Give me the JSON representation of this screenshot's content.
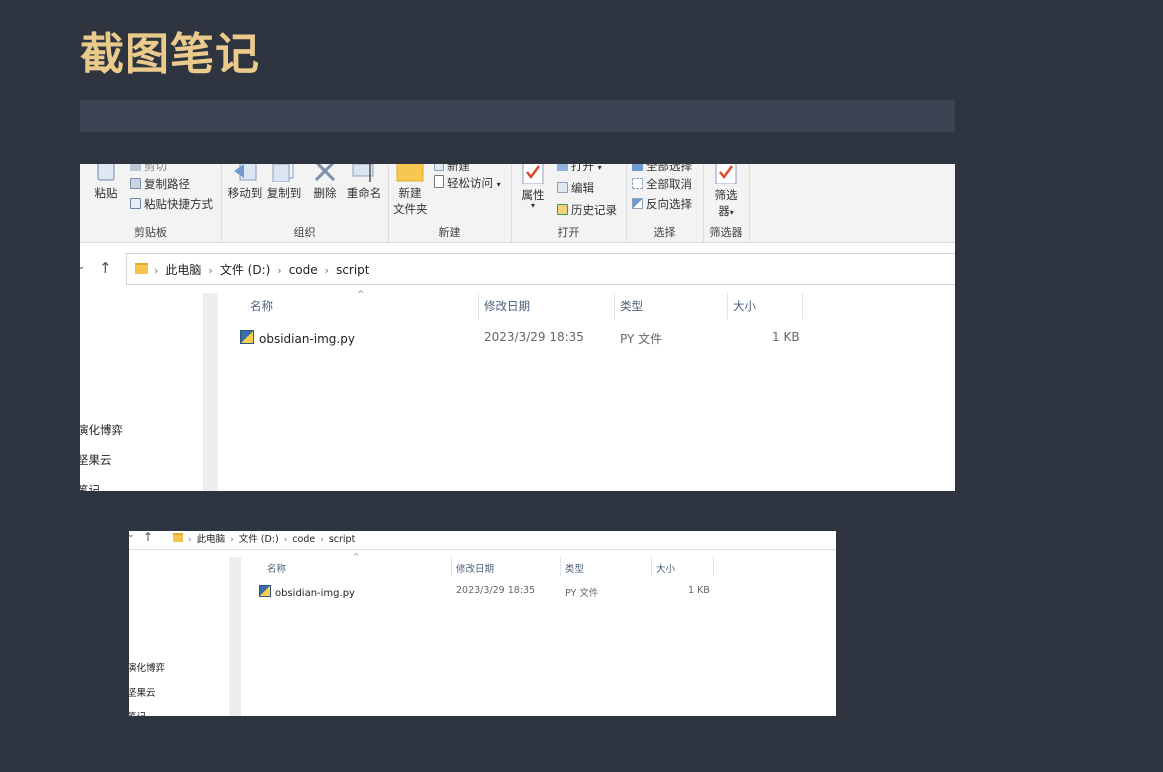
{
  "page": {
    "title": "截图笔记"
  },
  "shot1": {
    "ribbon": {
      "clipboard": {
        "paste": "粘贴",
        "cut": "剪切",
        "copy_path": "复制路径",
        "paste_shortcut": "粘贴快捷方式",
        "group": "剪贴板"
      },
      "organize": {
        "move_to": "移动到",
        "copy_to": "复制到",
        "delete": "删除",
        "rename": "重命名",
        "group": "组织"
      },
      "new": {
        "new_item": "新建",
        "easy_access": "轻松访问",
        "new_folder_1": "新建",
        "new_folder_2": "文件夹",
        "group": "新建"
      },
      "open": {
        "properties": "属性",
        "open": "打开",
        "edit": "编辑",
        "history": "历史记录",
        "group": "打开"
      },
      "select": {
        "select_all": "全部选择",
        "select_none": "全部取消",
        "invert": "反向选择",
        "group": "选择"
      },
      "filter": {
        "filter_1": "筛选",
        "filter_2": "器",
        "group": "筛选器"
      }
    },
    "address": {
      "crumbs": [
        "此电脑",
        "文件 (D:)",
        "code",
        "script"
      ]
    },
    "nav": {
      "items": [
        "演化博弈",
        "坚果云",
        "笔记"
      ]
    },
    "columns": [
      "名称",
      "修改日期",
      "类型",
      "大小"
    ],
    "rows": [
      {
        "name": "obsidian-img.py",
        "modified": "2023/3/29 18:35",
        "type": "PY 文件",
        "size": "1 KB"
      }
    ]
  },
  "shot2": {
    "address": {
      "crumbs": [
        "此电脑",
        "文件 (D:)",
        "code",
        "script"
      ]
    },
    "nav": {
      "items": [
        "演化博弈",
        "坚果云",
        "笔记"
      ]
    },
    "columns": [
      "名称",
      "修改日期",
      "类型",
      "大小"
    ],
    "rows": [
      {
        "name": "obsidian-img.py",
        "modified": "2023/3/29 18:35",
        "type": "PY 文件",
        "size": "1 KB"
      }
    ]
  },
  "colors": {
    "background": "#2e3440",
    "title": "#ebcb8b",
    "title_bar": "#3b4252"
  }
}
